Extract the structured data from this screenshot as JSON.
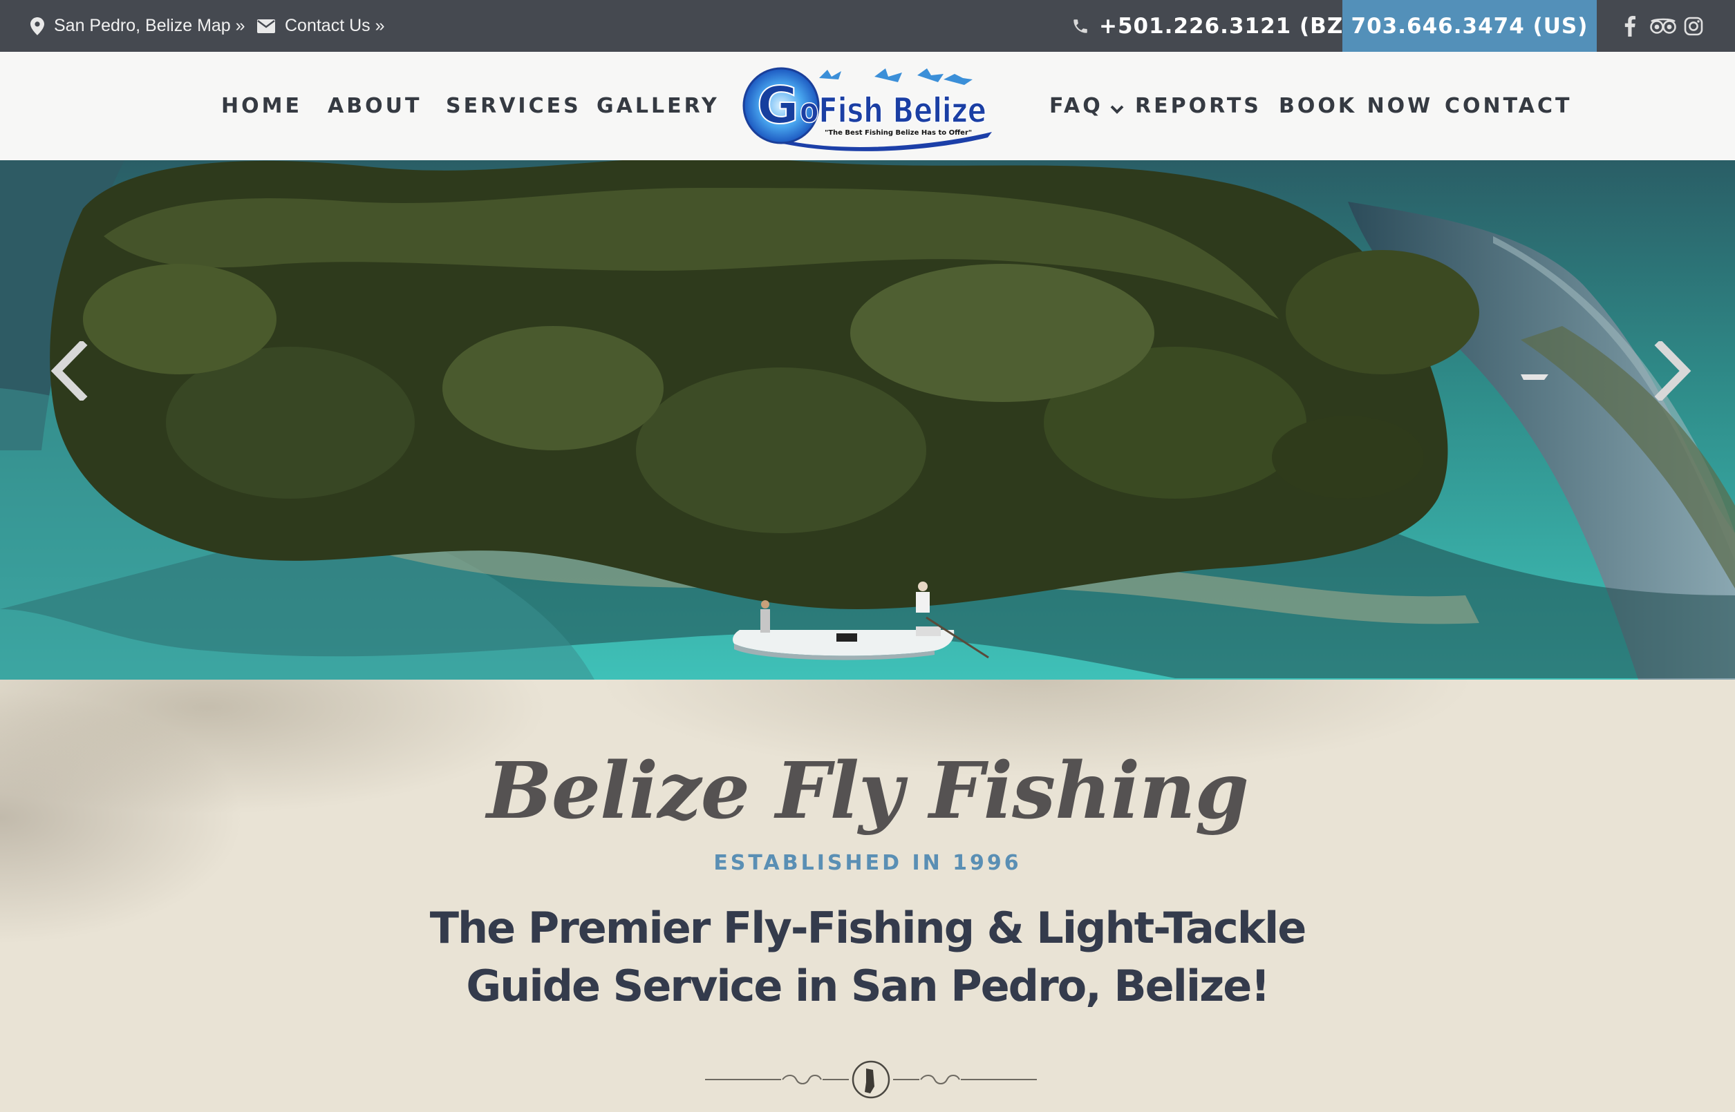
{
  "topbar": {
    "location_label": "San Pedro, Belize Map »",
    "contact_label": "Contact Us »",
    "phone_bz": "+501.226.3121 (BZ)",
    "phone_us": "703.646.3474 (US)",
    "bg_color": "#454950",
    "accent_color": "#5390b9"
  },
  "nav": {
    "items_left": [
      "HOME",
      "ABOUT",
      "SERVICES",
      "GALLERY"
    ],
    "items_right": [
      "FAQ",
      "REPORTS",
      "BOOK NOW",
      "CONTACT"
    ],
    "logo_text": "GoFish Belize",
    "logo_tagline": "\"The Best Fishing Belize Has to Offer\""
  },
  "hero": {
    "prev_icon": "chevron-left-icon",
    "next_icon": "chevron-right-icon"
  },
  "intro": {
    "title": "Belize Fly Fishing",
    "established": "ESTABLISHED IN 1996",
    "headline_line1": "The Premier Fly-Fishing & Light-Tackle",
    "headline_line2": "Guide Service in San Pedro, Belize!",
    "headline_color": "#343b4c",
    "established_color": "#5a8fb4"
  }
}
